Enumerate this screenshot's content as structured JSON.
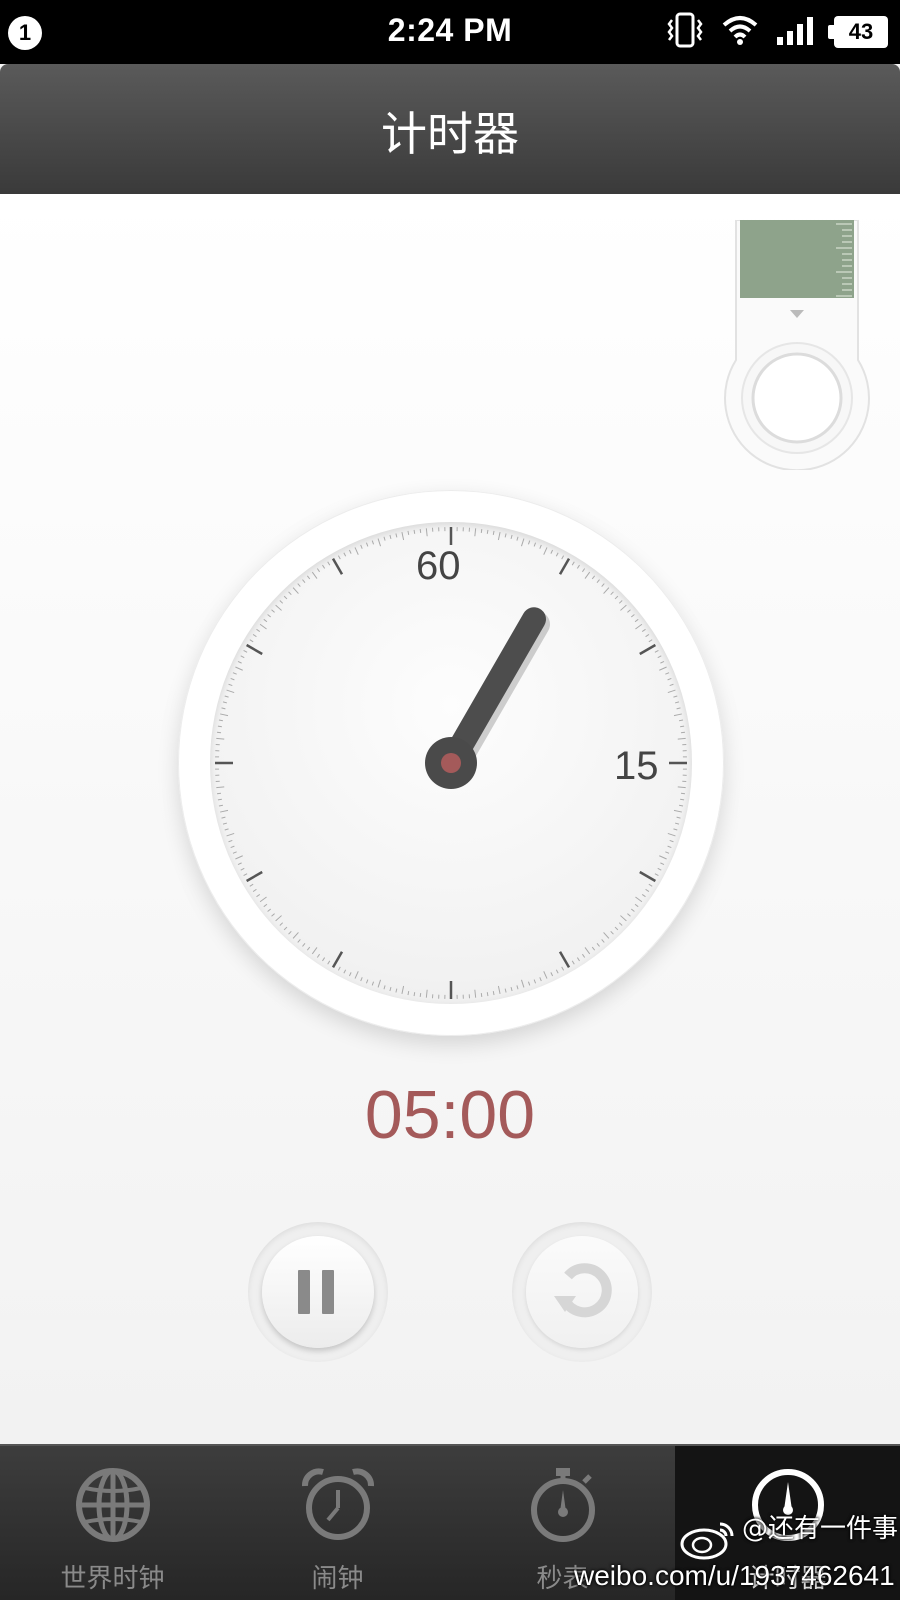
{
  "status_bar": {
    "notification_count": "1",
    "time": "2:24 PM",
    "battery": "43",
    "icons": [
      "vibrate-icon",
      "wifi-icon",
      "signal-icon",
      "battery-icon"
    ]
  },
  "header": {
    "title": "计时器"
  },
  "timer": {
    "dial_label_top": "60",
    "dial_label_right": "15",
    "readout": "05:00",
    "hand_minutes": 5,
    "accent_color": "#a45a5a",
    "preset_fill_fraction": 0.7
  },
  "controls": {
    "pause_icon": "pause-icon",
    "reset_icon": "reset-icon"
  },
  "tabs": [
    {
      "label": "世界时钟",
      "icon": "globe-icon",
      "active": false
    },
    {
      "label": "闹钟",
      "icon": "alarm-clock-icon",
      "active": false
    },
    {
      "label": "秒表",
      "icon": "stopwatch-icon",
      "active": false
    },
    {
      "label": "计时器",
      "icon": "timer-icon",
      "active": true
    }
  ],
  "watermark": {
    "handle": "@还有一件事",
    "url": "weibo.com/u/1937462641"
  }
}
